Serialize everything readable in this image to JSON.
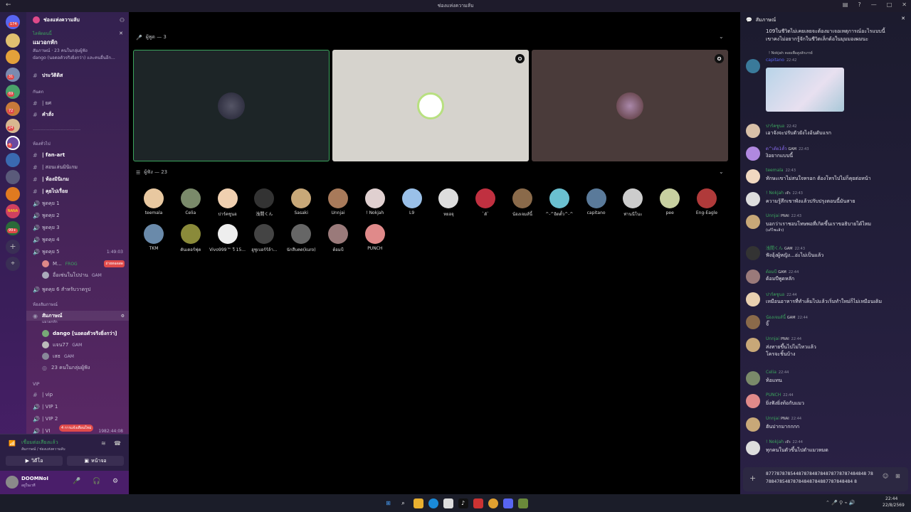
{
  "window": {
    "title": "ช่องแห่งความลับ"
  },
  "server": {
    "name": "ช่องแห่งความลับ",
    "event_label": "ไลฟ์ตอนนี้",
    "event_title": "แมวอกหัก",
    "event_sub1": "สัมภาษณ์ · 23 คนในกลุ่มผู้ฟัง",
    "event_sub2": "dango (นอดอตัวจริงยิ่งกว่า) และคนอื่นอีก..."
  },
  "guild_badges": [
    "174",
    "31",
    "69",
    "72",
    "24",
    "4",
    "99+"
  ],
  "channels": {
    "top": [
      {
        "name": "ประวัติดิส"
      }
    ],
    "cat_rules": "กันดก",
    "rules": [
      {
        "name": "| ยศ"
      },
      {
        "name": "คำสั่ง"
      }
    ],
    "divider": "-------------------------------",
    "cat_general": "ห้องทั่วไป",
    "general": [
      {
        "name": "| fan-art"
      },
      {
        "name": "| สอนเล่นมินิเกม"
      },
      {
        "name": "| ห้องมินิเกม"
      },
      {
        "name": "| คุยไปเรื่อย"
      }
    ],
    "voice": [
      {
        "name": "พูดคุย 1"
      },
      {
        "name": "พูดคุย 2"
      },
      {
        "name": "พูดคุย 3"
      },
      {
        "name": "พูดคุย 4"
      },
      {
        "name": "พูดคุย 5",
        "time": "1:49:03"
      }
    ],
    "voice5_users": [
      {
        "name": "M...",
        "tag": "FROG",
        "badge": "ถ่ายทอดสด"
      },
      {
        "name": "อื่อเซ่นในโปปาน",
        "tag": "GAM"
      }
    ],
    "voice6": "พูดคุย 6 สำหรับวาดรูป",
    "cat_stage": "ห้องสัมภาษณ์",
    "stage": {
      "name": "สัมภาษณ์",
      "sub": "แมวอกหัก",
      "users": [
        {
          "name": "dango [นอดอตัวจริงยิ่งกว่า]"
        },
        {
          "name": "แจน77",
          "tag": "GAM"
        },
        {
          "name": "เสธ",
          "tag": "GAM"
        }
      ],
      "listeners": "23 คนในกลุ่มผู้ฟัง"
    },
    "cat_vip": "VIP",
    "vip": [
      {
        "name": "| vip"
      },
      {
        "name": "| VIP 1"
      },
      {
        "name": "| VIP 2"
      },
      {
        "name": "| VI"
      }
    ],
    "vip_time": "1982:44:08",
    "new_badge": "4 การแจ้งเตือนใหม่"
  },
  "voice_panel": {
    "status": "เชื่อมต่อเสียงแล้ว",
    "channel": "สัมภาษณ์ / ช่องแห่งความลับ",
    "video": "วิดีโอ",
    "screen": "หน้าจอ"
  },
  "user": {
    "name": "DOOMNoI",
    "status": "อยู่ในเวที"
  },
  "stage": {
    "speakers_label": "ผู้พูด — 3",
    "listeners_label": "ผู้ฟัง — 23",
    "listeners": [
      "teemala",
      "Celia",
      "ปาร์คชูนอ",
      "浅間くん",
      "Sasaki",
      "Unnjai",
      "! Nokjah",
      "L9",
      "หยอจุ",
      "`ตั`",
      "น้องเจมส์นี้",
      "^-^อิดตั้ว^-^",
      "capitano",
      "ท่านนีโนะ",
      "pee",
      "Eng-Eagle",
      "TKM",
      "ดันเดอร์ฟุต",
      "Vivo999™ วี 15...",
      "ฮูซูเบอร์ร้ล้า...",
      "นักสืบคด(kuro)",
      "ต้อมบี",
      "PUNCH"
    ]
  },
  "chat": {
    "title": "สัมภาษณ์",
    "top_text1": "109ในชีวิตไม่เคยเลยจะต้องมาเจอเหตุการณ์อะไรแบบนี้",
    "top_text2": "เขาคงไม่อยากรู้จักในชีวิตเล็กด้อในมุมมองผมนะ",
    "reply_line": "! Nokjah  คอยเพื่อสูงสักเกรย์",
    "image_author": "capitano",
    "image_time": "22:42",
    "messages": [
      {
        "author": "ปาร์คชูนอ",
        "time": "22:42",
        "text": "เอาจังจะปรับตัวยังไงอ้นดับแรก",
        "color": "#3ba55d"
      },
      {
        "author": "ด^เด้ย1ตั้ว",
        "tag": "GAM",
        "time": "22:43",
        "text": "งิอยากแบบนี้",
        "color": "#8a6cf0"
      },
      {
        "author": "teemala",
        "time": "22:43",
        "text": "ทักษะเขาไม่สนใจหรอก ต้องโทรไปไม่ก็คุยต่อหน้า",
        "color": "#3ba55d"
      },
      {
        "author": "! Nokjah",
        "tag": "เจ๊ว",
        "time": "22:43",
        "text": "ความรู้สึกเขาพังแล้วปรับปรุงตอนนี้มันสาย",
        "color": "#3ba55d"
      },
      {
        "author": "Unnjai",
        "tag": "PNAI",
        "time": "22:43",
        "text": "บอกว่าเราชอบโทษพอที่เกิดขึ้นเราขอธิบายได้ไหม",
        "text2": "(แก้ไขแล้ว)",
        "color": "#3ba55d"
      },
      {
        "author": "浅間くん",
        "tag": "GAM",
        "time": "22:43",
        "text": "ฟังอุ้งผู้หญิง...อ่ะไม่เป็นแล้ว",
        "color": "#3ba55d"
      },
      {
        "author": "ต้อมบี",
        "tag": "GAM",
        "time": "22:44",
        "text": "ต้อมบีพูดหลัก",
        "color": "#3ba55d"
      },
      {
        "author": "ปาร์คชูนอ",
        "time": "22:44",
        "text": "เหมือนอาหารที่ทำเค็มไปแล้วเริ่มทำใหม่ก็ไม่เหมือนเดิม",
        "color": "#3ba55d"
      },
      {
        "author": "น้องเจมส์นี้",
        "tag": "GAM",
        "time": "22:44",
        "text": "จิ๊",
        "color": "#3ba55d"
      },
      {
        "author": "Unnjai",
        "tag": "PNAI",
        "time": "22:44",
        "text": "ส่งทายขึ้นไปไม่ไหวแล้ว",
        "text2": "โครจะชิ้นบ้าง",
        "color": "#3ba55d"
      },
      {
        "author": "Celia",
        "time": "22:44",
        "text": "ท้อแทน",
        "color": "#3ba55d"
      },
      {
        "author": "PUNCH",
        "time": "22:44",
        "text": "ยิ่งฟังยิ่งท้อกับแมว",
        "color": "#3ba55d"
      },
      {
        "author": "Unnjai",
        "tag": "PNAI",
        "time": "22:44",
        "text": "ฮันปากมากกกก",
        "color": "#3ba55d"
      },
      {
        "author": "! Nokjah",
        "tag": "เจ๊ว",
        "time": "22:44",
        "text": "ทุกคนในตัวขึ้นไปตำแมวหมด",
        "color": "#3ba55d"
      }
    ],
    "composer_text1": "8777878785448787848784878778787484848 78",
    "composer_text2": "78847854878784848784887787848484 8"
  },
  "clock": {
    "time": "22:44",
    "date": "22/8/2569"
  }
}
